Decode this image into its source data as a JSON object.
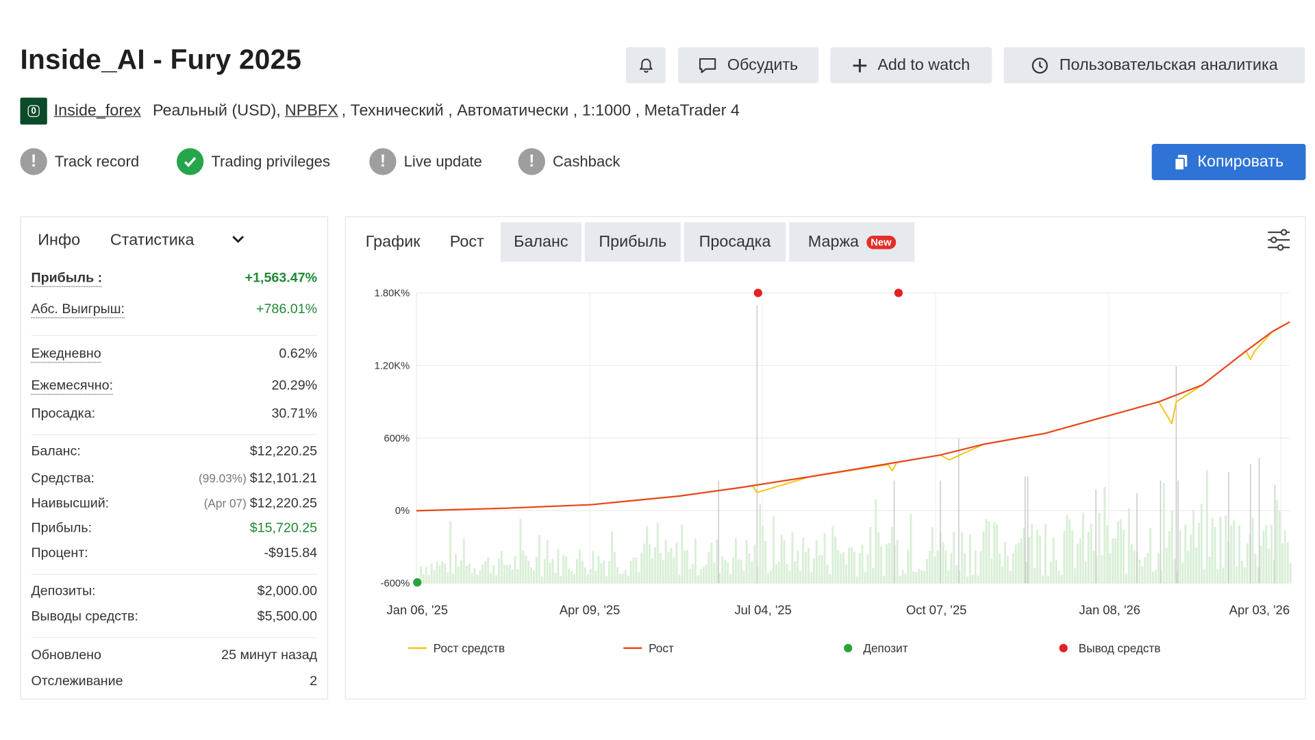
{
  "header": {
    "title": "Inside_AI - Fury 2025",
    "buttons": {
      "discuss": "Обсудить",
      "add_to_watch": "Add to watch",
      "analytics": "Пользовательская аналитика",
      "copy": "Копировать"
    }
  },
  "meta": {
    "author": "Inside_forex",
    "account": "Реальный (USD),",
    "broker": "NPBFX",
    "rest": ", Технический , Автоматически , 1:1000 , MetaTrader 4"
  },
  "badges": [
    "Track record",
    "Trading privileges",
    "Live update",
    "Cashback"
  ],
  "left_panel": {
    "tabs": [
      "Инфо",
      "Статистика"
    ],
    "profit": {
      "label": "Прибыль :",
      "value": "+1,563.47%"
    },
    "abs_gain": {
      "label": "Абс. Выигрыш:",
      "value": "+786.01%"
    },
    "daily": {
      "label": "Ежедневно",
      "value": "0.62%"
    },
    "monthly": {
      "label": "Ежемесячно:",
      "value": "20.29%"
    },
    "drawdown": {
      "label": "Просадка:",
      "value": "30.71%"
    },
    "balance": {
      "label": "Баланс:",
      "value": "$12,220.25"
    },
    "equity": {
      "label": "Средства:",
      "prefix": "(99.03%)",
      "value": "$12,101.21"
    },
    "highest": {
      "label": "Наивысший:",
      "prefix": "(Apr 07)",
      "value": "$12,220.25"
    },
    "profit_usd": {
      "label": "Прибыль:",
      "value": "$15,720.25"
    },
    "interest": {
      "label": "Процент:",
      "value": "-$915.84"
    },
    "deposits": {
      "label": "Депозиты:",
      "value": "$2,000.00"
    },
    "withdrawals": {
      "label": "Выводы средств:",
      "value": "$5,500.00"
    },
    "updated": {
      "label": "Обновлено",
      "value": "25 минут назад"
    },
    "tracking": {
      "label": "Отслеживание",
      "value": "2"
    }
  },
  "chart_tabs": {
    "chart": "График",
    "growth": "Рост",
    "balance": "Баланс",
    "profit": "Прибыль",
    "drawdown": "Просадка",
    "margin": "Маржа",
    "new_badge": "New"
  },
  "colors": {
    "growth": "#e8461c",
    "equity_growth": "#f2c418",
    "deposit": "#2aa33d",
    "withdrawal": "#e22222",
    "volume": "#d9efd6",
    "accent": "#2f73d6"
  },
  "chart_data": {
    "type": "line",
    "x_ticks": [
      "Jan 06, '25",
      "Apr 09, '25",
      "Jul 04, '25",
      "Oct 07, '25",
      "Jan 08, '26",
      "Apr 03, '26"
    ],
    "y_ticks": [
      "1.80K%",
      "1.20K%",
      "600%",
      "0%",
      "-600%"
    ],
    "ylim": [
      -600,
      1800
    ],
    "grid": true,
    "legend_position": "bottom",
    "series": [
      {
        "name": "Рост",
        "x": [
          0,
          0.1,
          0.2,
          0.3,
          0.37,
          0.45,
          0.55,
          0.6,
          0.65,
          0.72,
          0.78,
          0.85,
          0.9,
          0.95,
          0.98,
          1.0
        ],
        "values": [
          0,
          20,
          50,
          120,
          190,
          280,
          400,
          460,
          550,
          640,
          760,
          900,
          1040,
          1320,
          1480,
          1560
        ]
      },
      {
        "name": "Рост средств",
        "x": [
          0,
          0.1,
          0.2,
          0.3,
          0.37,
          0.385,
          0.39,
          0.45,
          0.54,
          0.545,
          0.55,
          0.6,
          0.61,
          0.65,
          0.72,
          0.78,
          0.85,
          0.865,
          0.87,
          0.9,
          0.95,
          0.955,
          0.96,
          0.98,
          1.0
        ],
        "values": [
          0,
          20,
          50,
          120,
          190,
          205,
          150,
          280,
          380,
          330,
          400,
          460,
          420,
          550,
          640,
          760,
          900,
          720,
          900,
          1040,
          1320,
          1250,
          1320,
          1480,
          1560
        ]
      }
    ],
    "deposits": [
      {
        "x": "Jan 06, '25",
        "value": -600
      }
    ],
    "withdrawals": [
      {
        "x": "Jul 04, '25",
        "value": 1800
      },
      {
        "x": "Sep 2025",
        "value": 1800
      }
    ],
    "legend": [
      "Рост средств",
      "Рост",
      "Депозит",
      "Вывод средств"
    ]
  }
}
